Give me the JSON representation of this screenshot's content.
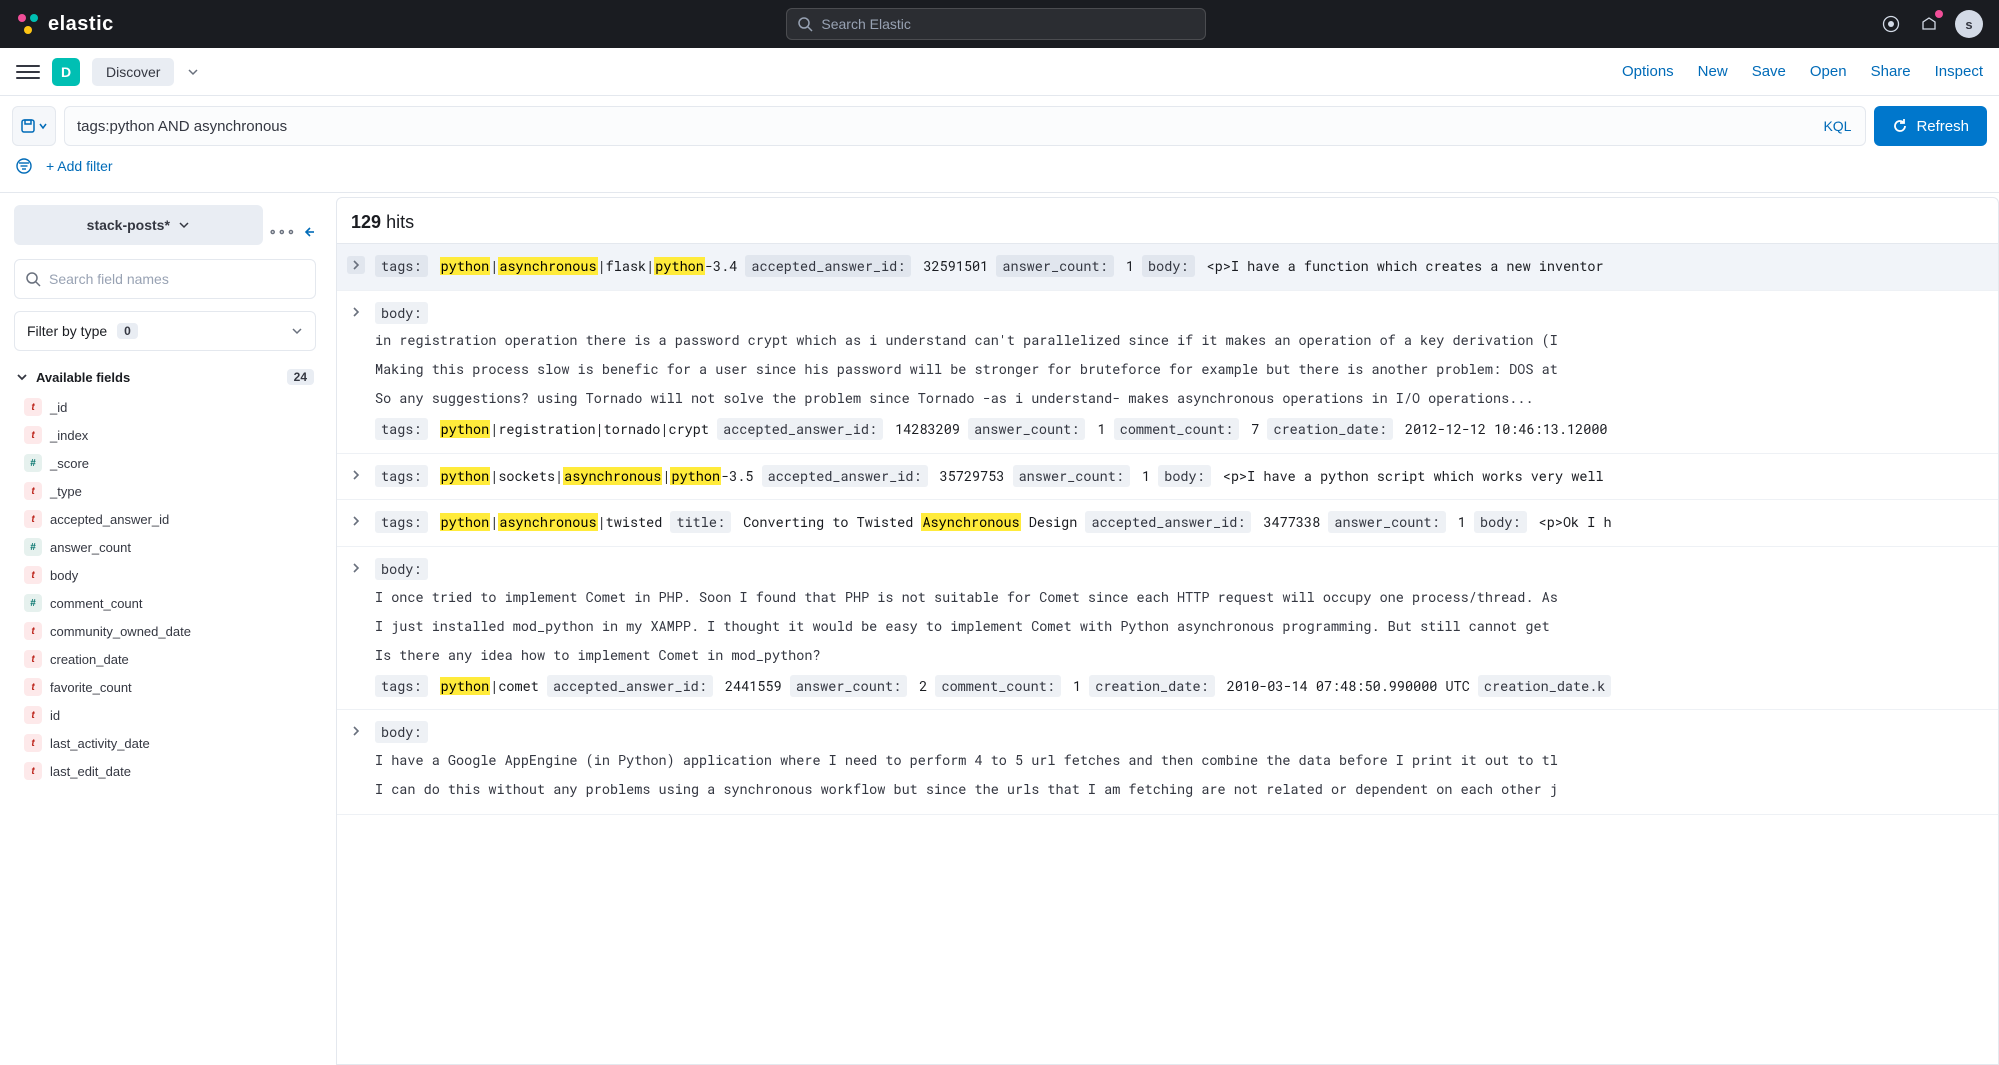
{
  "header": {
    "brand": "elastic",
    "search_placeholder": "Search Elastic",
    "avatar_initial": "s"
  },
  "subheader": {
    "app_badge": "D",
    "app_name": "Discover",
    "actions": [
      "Options",
      "New",
      "Save",
      "Open",
      "Share",
      "Inspect"
    ]
  },
  "query": {
    "value": "tags:python AND asynchronous",
    "lang": "KQL",
    "refresh_label": "Refresh"
  },
  "filter_row": {
    "add_filter": "+ Add filter"
  },
  "sidebar": {
    "index_pattern": "stack-posts*",
    "field_search_placeholder": "Search field names",
    "filter_by_type_label": "Filter by type",
    "filter_by_type_count": "0",
    "available_fields_label": "Available fields",
    "available_fields_count": "24",
    "fields": [
      {
        "type": "t",
        "name": "_id"
      },
      {
        "type": "t",
        "name": "_index"
      },
      {
        "type": "#",
        "name": "_score"
      },
      {
        "type": "t",
        "name": "_type"
      },
      {
        "type": "t",
        "name": "accepted_answer_id"
      },
      {
        "type": "#",
        "name": "answer_count"
      },
      {
        "type": "t",
        "name": "body"
      },
      {
        "type": "#",
        "name": "comment_count"
      },
      {
        "type": "t",
        "name": "community_owned_date"
      },
      {
        "type": "t",
        "name": "creation_date"
      },
      {
        "type": "t",
        "name": "favorite_count"
      },
      {
        "type": "t",
        "name": "id"
      },
      {
        "type": "t",
        "name": "last_activity_date"
      },
      {
        "type": "t",
        "name": "last_edit_date"
      }
    ]
  },
  "results": {
    "hits_count": "129",
    "hits_label": "hits",
    "docs": [
      {
        "selected": true,
        "segments": [
          {
            "label": "tags:",
            "parts": [
              {
                "t": "python",
                "hl": true
              },
              {
                "t": "|"
              },
              {
                "t": "asynchronous",
                "hl": true
              },
              {
                "t": "|flask|"
              },
              {
                "t": "python",
                "hl": true
              },
              {
                "t": "-3.4"
              }
            ]
          },
          {
            "label": "accepted_answer_id:",
            "value": "32591501"
          },
          {
            "label": "answer_count:",
            "value": "1"
          },
          {
            "label": "body:",
            "value": "<p>I have a function which creates a new inventor"
          }
        ]
      },
      {
        "body_lines": [
          "in registration operation there is a password crypt which as i understand can't parallelized since if it makes an operation of a key derivation (I",
          "Making this process slow is benefic for a user since his password will be stronger for bruteforce for example but there is another problem: DOS at",
          "So any suggestions? using Tornado will not solve the problem since Tornado -as i understand- makes asynchronous operations in I/O operations..."
        ],
        "segments": [
          {
            "label": "tags:",
            "parts": [
              {
                "t": "python",
                "hl": true
              },
              {
                "t": "|registration|tornado|crypt"
              }
            ]
          },
          {
            "label": "accepted_answer_id:",
            "value": "14283209"
          },
          {
            "label": "answer_count:",
            "value": "1"
          },
          {
            "label": "comment_count:",
            "value": "7"
          },
          {
            "label": "creation_date:",
            "value": "2012-12-12 10:46:13.12000"
          }
        ]
      },
      {
        "segments": [
          {
            "label": "tags:",
            "parts": [
              {
                "t": "python",
                "hl": true
              },
              {
                "t": "|sockets|"
              },
              {
                "t": "asynchronous",
                "hl": true
              },
              {
                "t": "|"
              },
              {
                "t": "python",
                "hl": true
              },
              {
                "t": "-3.5"
              }
            ]
          },
          {
            "label": "accepted_answer_id:",
            "value": "35729753"
          },
          {
            "label": "answer_count:",
            "value": "1"
          },
          {
            "label": "body:",
            "value": "<p>I have a python script which works very well"
          }
        ]
      },
      {
        "segments": [
          {
            "label": "tags:",
            "parts": [
              {
                "t": "python",
                "hl": true
              },
              {
                "t": "|"
              },
              {
                "t": "asynchronous",
                "hl": true
              },
              {
                "t": "|twisted"
              }
            ]
          },
          {
            "label": "title:",
            "parts": [
              {
                "t": "Converting to Twisted "
              },
              {
                "t": "Asynchronous",
                "hl": true
              },
              {
                "t": " Design"
              }
            ]
          },
          {
            "label": "accepted_answer_id:",
            "value": "3477338"
          },
          {
            "label": "answer_count:",
            "value": "1"
          },
          {
            "label": "body:",
            "value": "<p>Ok I h"
          }
        ]
      },
      {
        "body_lines": [
          "I once tried to implement Comet in PHP. Soon I found that PHP is not suitable for Comet since each HTTP request will occupy one process/thread. As",
          "I just installed mod_python in my XAMPP. I thought it would be easy to implement Comet with Python asynchronous programming. But still cannot get",
          "Is there any idea how to implement Comet in mod_python?"
        ],
        "segments": [
          {
            "label": "tags:",
            "parts": [
              {
                "t": "python",
                "hl": true
              },
              {
                "t": "|comet"
              }
            ]
          },
          {
            "label": "accepted_answer_id:",
            "value": "2441559"
          },
          {
            "label": "answer_count:",
            "value": "2"
          },
          {
            "label": "comment_count:",
            "value": "1"
          },
          {
            "label": "creation_date:",
            "value": "2010-03-14 07:48:50.990000 UTC"
          },
          {
            "label": "creation_date.k",
            "value": ""
          }
        ]
      },
      {
        "body_lines": [
          "I have a Google AppEngine (in Python) application where I need to perform 4 to 5 url fetches and then combine the data before I print it out to tl",
          "I can do this without any problems using a synchronous workflow but since the urls that I am fetching are not related or dependent on each other j"
        ],
        "segments": []
      }
    ]
  }
}
